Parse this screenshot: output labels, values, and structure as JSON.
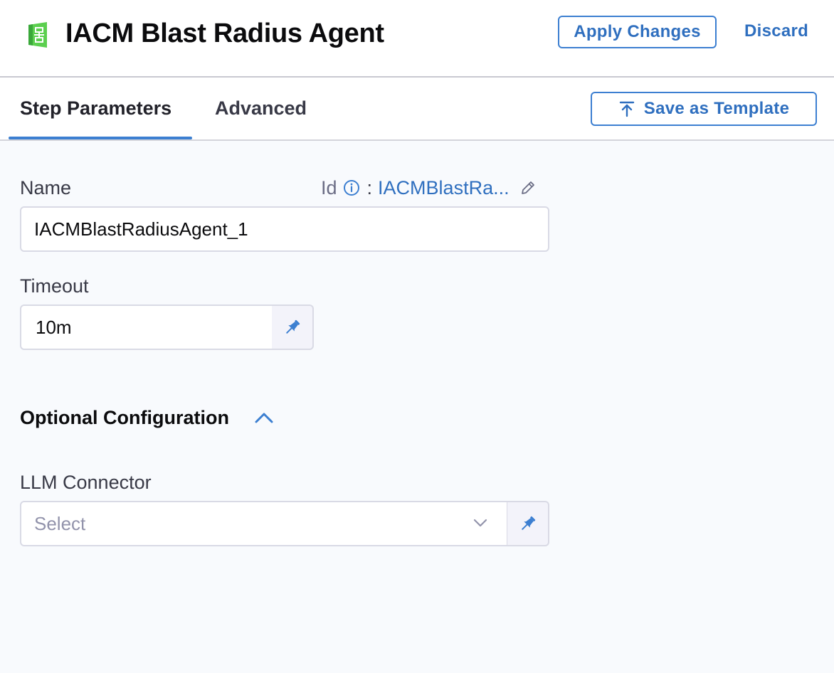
{
  "header": {
    "title": "IACM Blast Radius Agent",
    "app_icon": "iacm-agent-icon",
    "apply_label": "Apply Changes",
    "discard_label": "Discard"
  },
  "tabs": [
    {
      "label": "Step Parameters",
      "active": true
    },
    {
      "label": "Advanced",
      "active": false
    }
  ],
  "save_template_label": "Save as Template",
  "form": {
    "name_label": "Name",
    "id_label": "Id",
    "id_colon": ":",
    "id_value": "IACMBlastRa...",
    "name_value": "IACMBlastRadiusAgent_1",
    "timeout_label": "Timeout",
    "timeout_value": "10m",
    "optional_section": "Optional Configuration",
    "optional_expanded": true,
    "llm_label": "LLM Connector",
    "llm_placeholder": "Select"
  },
  "colors": {
    "accent": "#3c7fd1",
    "icon_green": "#4cc94c",
    "background": "#f8fafd"
  }
}
